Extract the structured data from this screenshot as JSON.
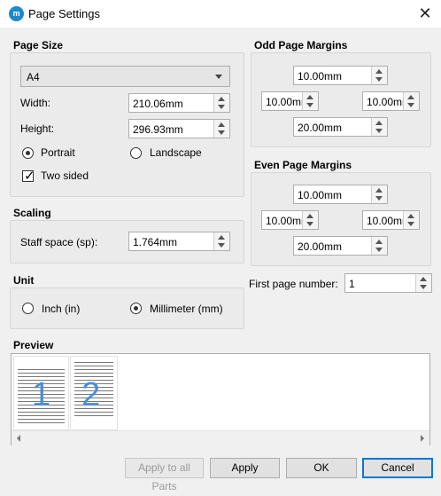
{
  "window": {
    "title": "Page Settings",
    "app_icon": "musescore-icon",
    "close_icon": "close-icon",
    "close_glyph": "✕",
    "app_glyph": "m"
  },
  "page_size": {
    "section_title": "Page Size",
    "preset": "A4",
    "width_label": "Width:",
    "width_value": "210.06mm",
    "height_label": "Height:",
    "height_value": "296.93mm",
    "portrait_label": "Portrait",
    "landscape_label": "Landscape",
    "orientation": "Portrait",
    "two_sided_label": "Two sided",
    "two_sided_checked": true,
    "check_glyph": "✓"
  },
  "scaling": {
    "section_title": "Scaling",
    "staff_space_label": "Staff space (sp):",
    "staff_space_value": "1.764mm"
  },
  "unit": {
    "section_title": "Unit",
    "inch_label": "Inch (in)",
    "mm_label": "Millimeter (mm)",
    "selected": "Millimeter (mm)"
  },
  "odd_margins": {
    "section_title": "Odd Page Margins",
    "top": "10.00mm",
    "left": "10.00mn",
    "right": "10.00mn",
    "bottom": "20.00mm"
  },
  "even_margins": {
    "section_title": "Even Page Margins",
    "top": "10.00mm",
    "left": "10.00mn",
    "right": "10.00mn",
    "bottom": "20.00mm"
  },
  "first_page": {
    "label": "First page number:",
    "value": "1"
  },
  "preview": {
    "section_title": "Preview",
    "page1_number": "1",
    "page2_number": "2"
  },
  "buttons": {
    "apply_all": "Apply to all Parts",
    "apply": "Apply",
    "ok": "OK",
    "cancel": "Cancel"
  },
  "colors": {
    "accent": "#0078d7",
    "page_number": "#4a8ed4",
    "app_icon": "#1b88d0"
  }
}
